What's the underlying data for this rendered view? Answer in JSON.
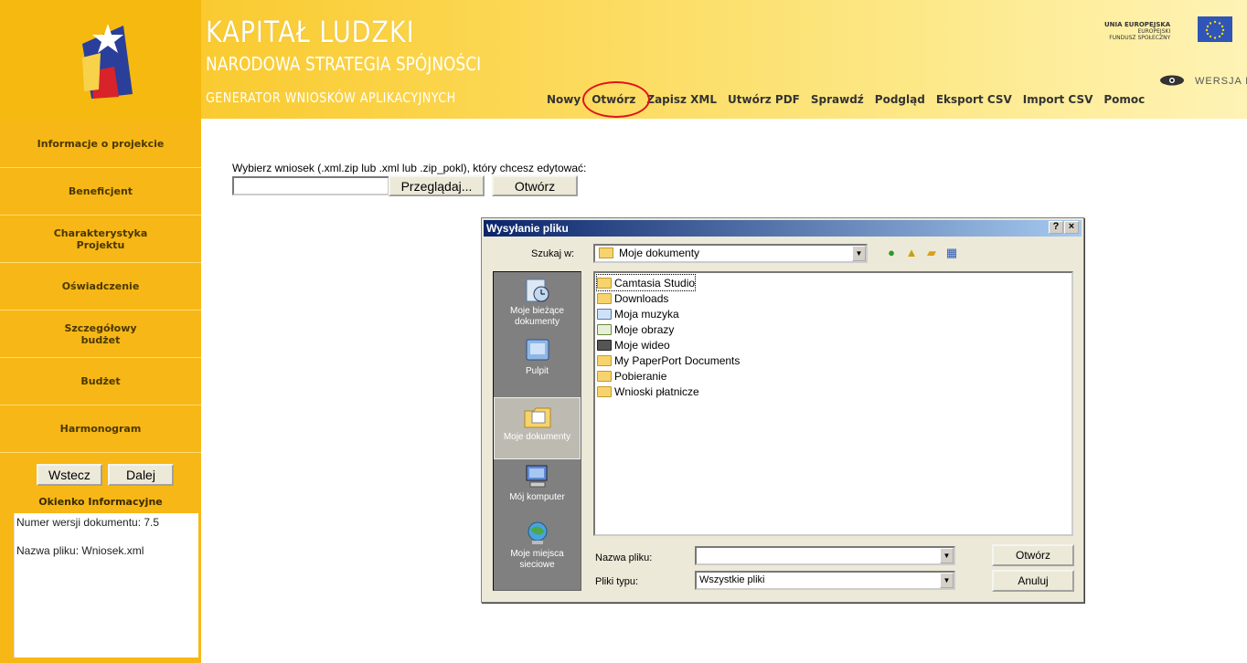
{
  "header": {
    "brand_title": "KAPITAŁ LUDZKI",
    "brand_subtitle": "NARODOWA STRATEGIA SPÓJNOŚCI",
    "generator": "GENERATOR WNIOSKÓW APLIKACYJNYCH",
    "eu_line1": "UNIA EUROPEJSKA",
    "eu_line2": "EUROPEJSKI",
    "eu_line3": "FUNDUSZ SPOŁECZNY",
    "version_link": "WERSJA D",
    "menu": [
      "Nowy",
      "Otwórz",
      "Zapisz XML",
      "Utwórz PDF",
      "Sprawdź",
      "Podgląd",
      "Eksport CSV",
      "Import CSV",
      "Pomoc"
    ]
  },
  "sidebar": {
    "items": [
      {
        "label": "Informacje o projekcie"
      },
      {
        "label": "Beneficjent"
      },
      {
        "label": "Charakterystyka Projektu"
      },
      {
        "label": "Oświadczenie"
      },
      {
        "label": "Szczegółowy budżet"
      },
      {
        "label": "Budżet"
      },
      {
        "label": "Harmonogram"
      }
    ],
    "back_label": "Wstecz",
    "next_label": "Dalej",
    "info_title": "Okienko Informacyjne",
    "info_version": "Numer wersji dokumentu: 7.5",
    "info_filename": "Nazwa pliku: Wniosek.xml"
  },
  "main": {
    "prompt": "Wybierz wniosek (.xml.zip lub .xml lub .zip_pokl), który chcesz edytować:",
    "browse_label": "Przeglądaj...",
    "open_label": "Otwórz"
  },
  "dialog": {
    "title": "Wysyłanie pliku",
    "help_btn": "?",
    "close_btn": "×",
    "look_in_label": "Szukaj w:",
    "look_in_value": "Moje dokumenty",
    "places": [
      {
        "label": "Moje bieżące dokumenty"
      },
      {
        "label": "Pulpit"
      },
      {
        "label": "Moje dokumenty"
      },
      {
        "label": "Mój komputer"
      },
      {
        "label": "Moje miejsca sieciowe"
      }
    ],
    "files": [
      {
        "name": "Camtasia Studio"
      },
      {
        "name": "Downloads"
      },
      {
        "name": "Moja muzyka"
      },
      {
        "name": "Moje obrazy"
      },
      {
        "name": "Moje wideo"
      },
      {
        "name": "My PaperPort Documents"
      },
      {
        "name": "Pobieranie"
      },
      {
        "name": "Wnioski płatnicze"
      }
    ],
    "filename_label": "Nazwa pliku:",
    "filename_value": "",
    "filetype_label": "Pliki typu:",
    "filetype_value": "Wszystkie pliki",
    "open_btn": "Otwórz",
    "cancel_btn": "Anuluj"
  },
  "colors": {
    "sidebar_bg": "#f7b716",
    "accent_circle": "#e0141a",
    "dialog_title": "#0a246a"
  }
}
